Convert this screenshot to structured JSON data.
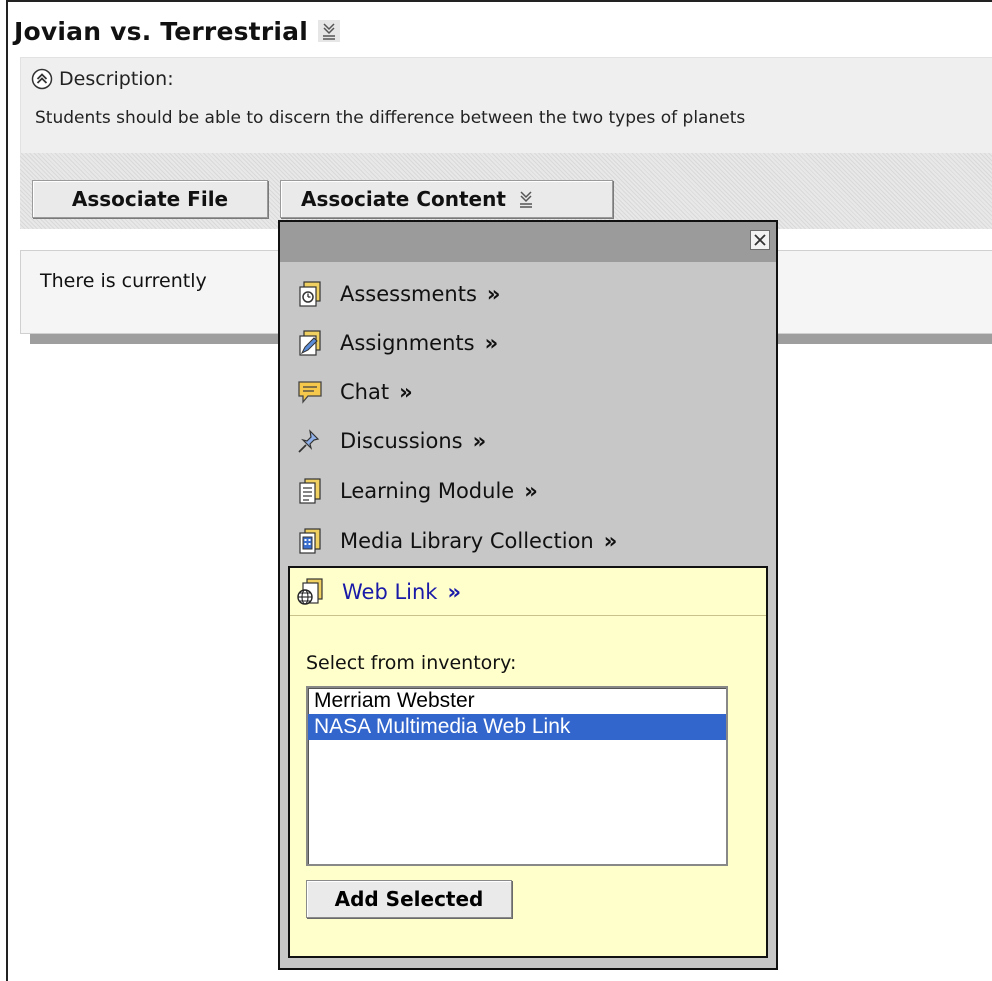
{
  "page": {
    "title": "Jovian vs. Terrestrial"
  },
  "description": {
    "label": "Description:",
    "text": "Students should be able to discern the difference between the two types of planets"
  },
  "toolbar": {
    "associate_file": "Associate File",
    "associate_content": "Associate Content"
  },
  "content": {
    "empty_message": "There is currently"
  },
  "popup": {
    "menu": [
      {
        "label": "Assessments",
        "icon": "assessments-icon"
      },
      {
        "label": "Assignments",
        "icon": "assignments-icon"
      },
      {
        "label": "Chat",
        "icon": "chat-icon"
      },
      {
        "label": "Discussions",
        "icon": "discussions-icon"
      },
      {
        "label": "Learning Module",
        "icon": "learning-module-icon"
      },
      {
        "label": "Media Library Collection",
        "icon": "media-library-icon"
      }
    ],
    "chevron": "»",
    "web_link": {
      "label": "Web Link",
      "select_label": "Select from inventory:",
      "options": [
        "Merriam Webster",
        "NASA Multimedia Web Link"
      ],
      "selected": "NASA Multimedia Web Link",
      "add_button": "Add Selected"
    }
  },
  "colors": {
    "popup_bg": "#c7c7c7",
    "weblink_bg": "#ffffcc",
    "link_blue": "#1a1aa8",
    "selection": "#3366cc"
  }
}
